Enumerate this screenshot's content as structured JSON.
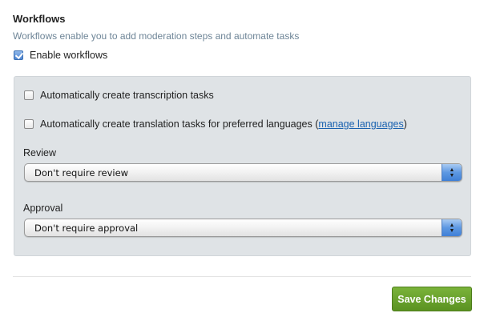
{
  "workflows": {
    "title": "Workflows",
    "description": "Workflows enable you to add moderation steps and automate tasks",
    "enable_checkbox": {
      "label": "Enable workflows",
      "checked": true
    }
  },
  "panel": {
    "transcription": {
      "label": "Automatically create transcription tasks",
      "checked": false
    },
    "translation": {
      "label_before": "Automatically create translation tasks for preferred languages (",
      "link_text": "manage languages",
      "label_after": ")",
      "checked": false
    },
    "review": {
      "label": "Review",
      "selected": "Don't require review"
    },
    "approval": {
      "label": "Approval",
      "selected": "Don't require approval"
    }
  },
  "actions": {
    "save_label": "Save Changes"
  },
  "colors": {
    "save_button": "#6aa32d",
    "panel_bg": "#dfe3e6",
    "link": "#1a62b0",
    "description_text": "#6e8597"
  },
  "icons": {
    "select_arrow": "up-down-arrows-icon",
    "checkbox_check": "checkmark-icon"
  }
}
